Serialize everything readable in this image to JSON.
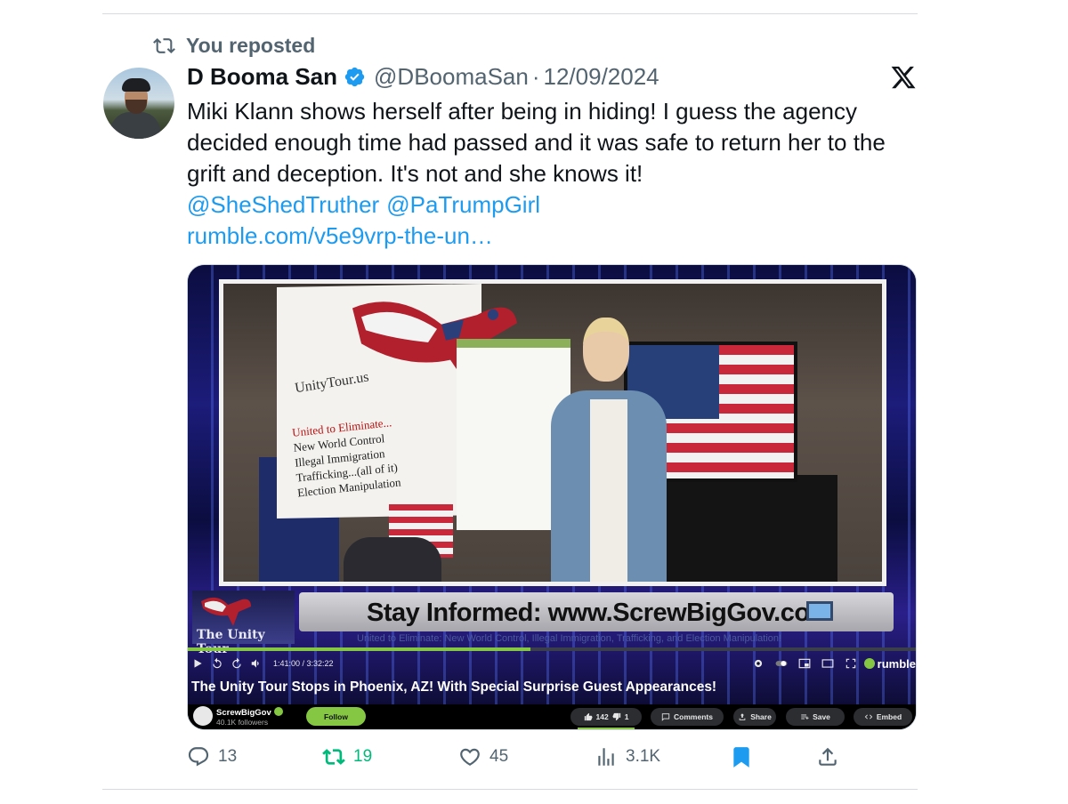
{
  "repost": {
    "label": "You reposted"
  },
  "author": {
    "name": "D Booma San",
    "handle": "@DBoomaSan",
    "separator": "·",
    "date": "12/09/2024"
  },
  "tweet": {
    "text": "Miki Klann shows herself after being in hiding! I guess the agency decided enough time had passed and it was safe to return her to the grift and deception. It's not and she knows it!",
    "mentions": [
      "@SheShedTruther",
      "@PaTrumpGirl"
    ],
    "link": "rumble.com/v5e9vrp-the-un…"
  },
  "video": {
    "banner_site": "UnityTour.us",
    "banner_lines": [
      "United to Eliminate...",
      "New World Control",
      "Illegal Immigration",
      "Trafficking...(all of it)",
      "Election Manipulation"
    ],
    "ticker_logo": "The Unity Tour",
    "ticker_text": "Stay Informed: www.ScrewBigGov.com",
    "scroll_text": "United to Eliminate: New World Control, Illegal Immigration, Trafficking, and Election Manipulation!",
    "timecode": "1:41:00 / 3:32:22",
    "progress": 0.47,
    "brand": "rumble",
    "title": "The Unity Tour Stops in Phoenix, AZ! With Special Surprise Guest Appearances!",
    "channel": {
      "name": "ScrewBigGov",
      "followers": "40.1K followers",
      "follow_label": "Follow"
    },
    "votes": {
      "up": "142",
      "down": "1"
    },
    "buttons": {
      "comments": "Comments",
      "share": "Share",
      "save": "Save",
      "embed": "Embed"
    }
  },
  "actions": {
    "replies": "13",
    "reposts": "19",
    "likes": "45",
    "views": "3.1K"
  },
  "colors": {
    "accent": "#1d9bf0",
    "repost_green": "#00ba7c",
    "muted": "#536471",
    "rumble_green": "#85c742"
  },
  "icons": [
    "repost-icon",
    "verified-badge-icon",
    "x-logo-icon",
    "reply-icon",
    "like-icon",
    "views-icon",
    "bookmark-icon",
    "share-icon"
  ]
}
